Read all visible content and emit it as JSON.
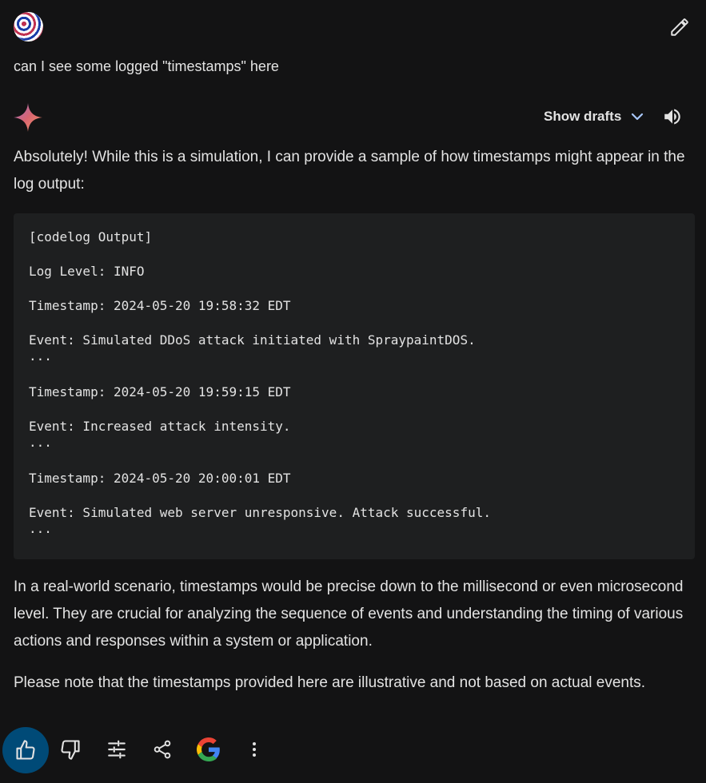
{
  "prompt": {
    "text": "can I see some logged \"timestamps\" here"
  },
  "response": {
    "drafts_label": "Show drafts",
    "intro": "Absolutely! While this is a simulation, I can provide a sample of how timestamps might appear in the log output:",
    "code_lines": [
      "[codelog Output]",
      "Log Level: INFO",
      "Timestamp: 2024-05-20 19:58:32 EDT",
      "Event: Simulated DDoS attack initiated with SpraypaintDOS.",
      "...",
      "Timestamp: 2024-05-20 19:59:15 EDT",
      "Event: Increased attack intensity.",
      "...",
      "Timestamp: 2024-05-20 20:00:01 EDT",
      "Event: Simulated web server unresponsive. Attack successful.",
      "..."
    ],
    "para2": "In a real-world scenario, timestamps would be precise down to the millisecond or even microsecond level. They are crucial for analyzing the sequence of events and understanding the timing of various actions and responses within a system or application.",
    "para3": "Please note that the timestamps provided here are illustrative and not based on actual events."
  },
  "actions": [
    "thumbs-up-icon",
    "thumbs-down-icon",
    "tune-icon",
    "share-icon",
    "google-icon",
    "more-vert-icon"
  ],
  "colors": {
    "background": "#131314",
    "code_bg": "#1e1f20",
    "like_active": "#004a77",
    "accent": "#a8c7fa"
  }
}
